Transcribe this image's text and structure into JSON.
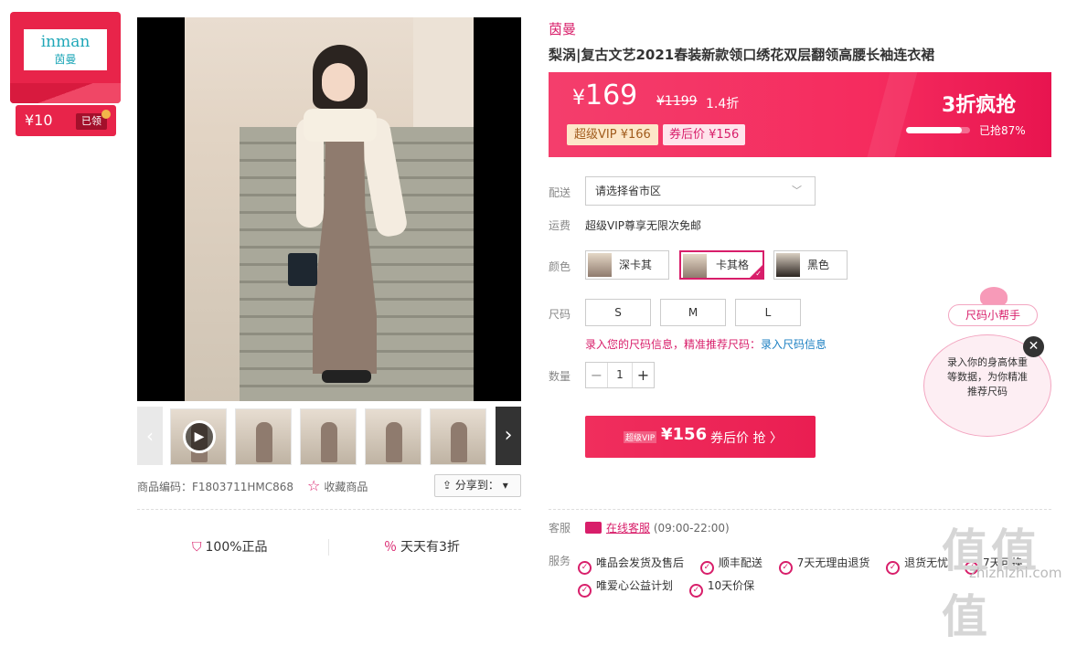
{
  "brand_card": {
    "logo_en": "inman",
    "logo_cn": "茵曼"
  },
  "coupon": {
    "amount": "¥10",
    "status": "已领"
  },
  "product": {
    "brand": "茵曼",
    "title": "梨涡|复古文艺2021春装新款领口绣花双层翻领高腰长袖连衣裙",
    "code": "商品编码：F1803711HMC868",
    "favorite": "收藏商品",
    "share": "分享到："
  },
  "price": {
    "currency": "¥",
    "now": "169",
    "old": "¥1199",
    "discount": "1.4折",
    "vip_tag": "超级VIP ¥166",
    "coupon_tag": "券后价 ¥156",
    "flash_title": "3折疯抢",
    "flash_progress": 0.87,
    "flash_pct_text": "已抢87%"
  },
  "labels": {
    "delivery": "配送",
    "shipping": "运费",
    "color": "颜色",
    "size": "尺码",
    "quantity": "数量",
    "service_contact": "客服",
    "services": "服务"
  },
  "delivery": {
    "placeholder": "请选择省市区"
  },
  "shipping_text": "超级VIP尊享无限次免邮",
  "colors": [
    {
      "label": "深卡其",
      "selected": false
    },
    {
      "label": "卡其格",
      "selected": true
    },
    {
      "label": "黑色",
      "selected": false
    }
  ],
  "sizes": [
    "S",
    "M",
    "L"
  ],
  "size_hint": {
    "part1": "录入您的尺码信息，精准推荐尺码：",
    "part2": "录入尺码信息"
  },
  "quantity": "1",
  "buy_button": {
    "vip": "超级VIP",
    "price": "¥156",
    "suffix": "券后价 抢 〉"
  },
  "customer_service": {
    "link": "在线客服",
    "hours": "(09:00-22:00)"
  },
  "services": [
    "唯品会发货及售后",
    "顺丰配送",
    "7天无理由退货",
    "退货无忧",
    "7天可换",
    "唯爱心公益计划",
    "10天价保"
  ],
  "assurances": [
    "100%正品",
    "天天有3折"
  ],
  "size_helper": {
    "title": "尺码小帮手",
    "text": "录入你的身高体重等数据，为你精准推荐尺码"
  },
  "watermark": {
    "main": "值值值",
    "sub": "zhizhizhi.com"
  },
  "colors_theme": {
    "accent": "#d81e6a",
    "price_bar": "#f52b5e",
    "brand_red": "#e8244a"
  }
}
